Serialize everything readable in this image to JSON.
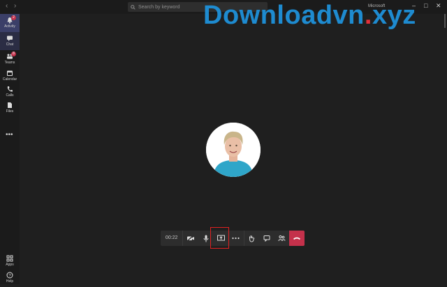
{
  "titlebar": {
    "back_icon": "chevron-left-icon",
    "forward_icon": "chevron-right-icon",
    "search_placeholder": "Search by keyword",
    "account_label": "Microsoft",
    "window_controls": [
      "minimize-icon",
      "maximize-icon",
      "close-icon"
    ]
  },
  "rail": {
    "items": [
      {
        "label": "Activity",
        "icon": "bell-icon",
        "badge": "2",
        "active": true
      },
      {
        "label": "Chat",
        "icon": "chat-icon",
        "active": false
      },
      {
        "label": "Teams",
        "icon": "teams-icon",
        "badge": "8"
      },
      {
        "label": "Calendar",
        "icon": "calendar-icon"
      },
      {
        "label": "Calls",
        "icon": "phone-icon"
      },
      {
        "label": "Files",
        "icon": "file-icon"
      }
    ],
    "more_label": "•••",
    "bottom": [
      {
        "label": "Apps",
        "icon": "apps-icon"
      },
      {
        "label": "Help",
        "icon": "help-icon"
      }
    ]
  },
  "watermark": {
    "main": "Downloadvn",
    "dot": ".",
    "tld": "xyz"
  },
  "call": {
    "timer": "00:22",
    "buttons": [
      "video-off-icon",
      "microphone-icon",
      "share-screen-icon",
      "more-icon",
      "raise-hand-icon",
      "chat-icon",
      "participants-icon",
      "hang-up-icon"
    ]
  },
  "colors": {
    "accent": "#3b3f68",
    "hangup": "#c4314b",
    "highlight": "#e02020"
  }
}
